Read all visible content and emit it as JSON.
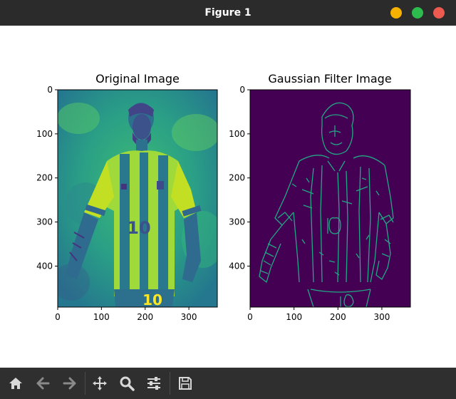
{
  "window": {
    "title": "Figure 1"
  },
  "window_controls": {
    "minimize_color": "#f6b100",
    "maximize_color": "#2dbb4e",
    "close_color": "#ed5a4f"
  },
  "figure": {
    "left_title": "Original Image",
    "right_title": "Gaussian Filter Image",
    "x_ticks": [
      "0",
      "100",
      "200",
      "300"
    ],
    "y_ticks": [
      "0",
      "100",
      "200",
      "300",
      "400"
    ],
    "image_extent": {
      "width": 365,
      "height": 493
    },
    "left_colormap": "viridis",
    "right_background_color": "#440154",
    "right_edge_color": "#22a884"
  },
  "toolbar": {
    "items": [
      {
        "name": "home-icon",
        "label": "Home"
      },
      {
        "name": "back-icon",
        "label": "Back"
      },
      {
        "name": "forward-icon",
        "label": "Forward"
      },
      {
        "name": "pan-icon",
        "label": "Pan"
      },
      {
        "name": "zoom-icon",
        "label": "Zoom"
      },
      {
        "name": "configure-subplots-icon",
        "label": "Configure subplots"
      },
      {
        "name": "save-icon",
        "label": "Save"
      }
    ]
  }
}
